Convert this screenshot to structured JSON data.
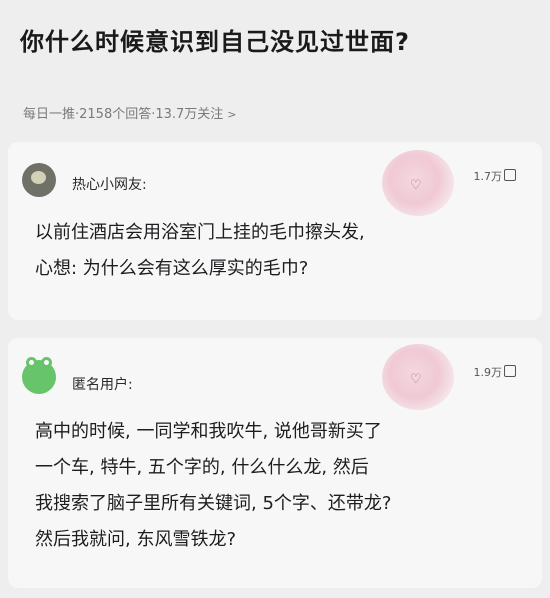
{
  "question": {
    "title": "你什么时候意识到自己没见过世面?",
    "meta": "每日一推·2158个回答·13.7万关注",
    "meta_chevron": ">"
  },
  "answers": [
    {
      "username": "热心小网友:",
      "likes": "1.7万",
      "avatar_icon": "cat-avatar-icon",
      "lines": [
        "以前住酒店会用浴室门上挂的毛巾擦头发,",
        "心想: 为什么会有这么厚实的毛巾?"
      ]
    },
    {
      "username": "匿名用户:",
      "likes": "1.9万",
      "avatar_icon": "frog-avatar-icon",
      "lines": [
        "高中的时候, 一同学和我吹牛, 说他哥新买了",
        "一个车, 特牛, 五个字的, 什么什么龙, 然后",
        "我搜索了脑子里所有关键词, 5个字、还带龙?",
        "然后我就问, 东风雪铁龙?"
      ]
    }
  ],
  "colors": {
    "background": "#eeeeef",
    "card": "#f7f7f8",
    "meta_text": "#7a7a7a"
  }
}
